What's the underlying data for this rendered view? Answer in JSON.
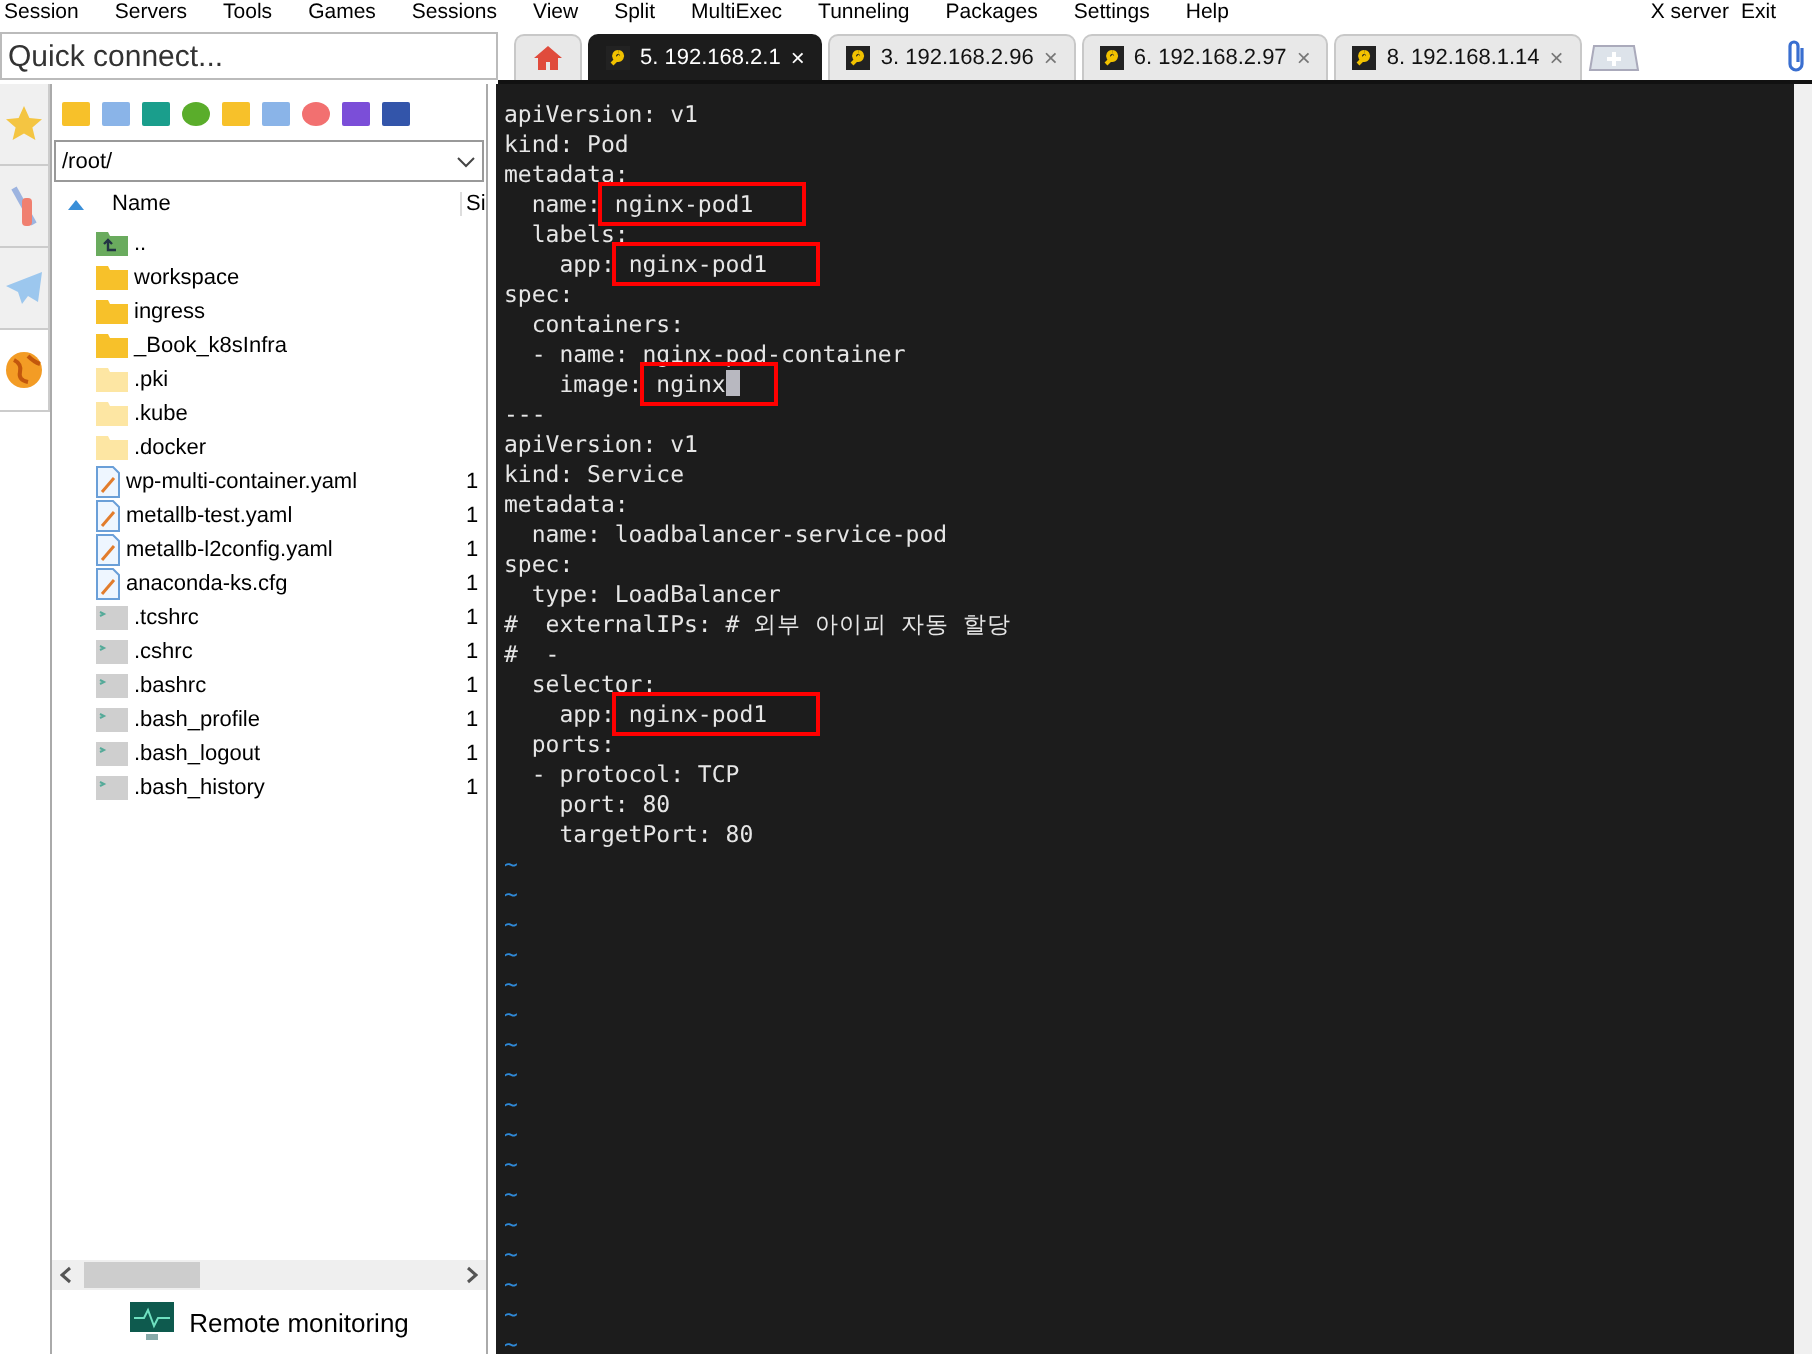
{
  "menu": [
    "Session",
    "Servers",
    "Tools",
    "Games",
    "Sessions",
    "View",
    "Split",
    "MultiExec",
    "Tunneling",
    "Packages",
    "Settings",
    "Help",
    "X server",
    "Exit"
  ],
  "quick_connect": {
    "placeholder": "Quick connect..."
  },
  "tabs": [
    {
      "kind": "home",
      "selected": false
    },
    {
      "kind": "session",
      "label": "5. 192.168.2.1",
      "close": "×",
      "selected": true
    },
    {
      "kind": "session",
      "label": "3. 192.168.2.96",
      "close": "×",
      "selected": false
    },
    {
      "kind": "session",
      "label": "6. 192.168.2.97",
      "close": "×",
      "selected": false
    },
    {
      "kind": "session",
      "label": "8. 192.168.1.14",
      "close": "×",
      "selected": false
    }
  ],
  "side_tabs": [
    {
      "kind": "star",
      "selected": false
    },
    {
      "kind": "tools",
      "selected": false
    },
    {
      "kind": "plane",
      "selected": false
    },
    {
      "kind": "globe",
      "selected": true
    }
  ],
  "file_browser": {
    "path": "/root/",
    "columns": [
      "Name",
      "Si"
    ],
    "rows": [
      {
        "kind": "parent",
        "name": "..",
        "size": ""
      },
      {
        "kind": "folder",
        "name": "workspace",
        "size": ""
      },
      {
        "kind": "folder",
        "name": "ingress",
        "size": ""
      },
      {
        "kind": "folder",
        "name": "_Book_k8sInfra",
        "size": ""
      },
      {
        "kind": "hidden_folder",
        "name": ".pki",
        "size": ""
      },
      {
        "kind": "hidden_folder",
        "name": ".kube",
        "size": ""
      },
      {
        "kind": "hidden_folder",
        "name": ".docker",
        "size": ""
      },
      {
        "kind": "text_file",
        "name": "wp-multi-container.yaml",
        "size": "1"
      },
      {
        "kind": "text_file",
        "name": "metallb-test.yaml",
        "size": "1"
      },
      {
        "kind": "text_file",
        "name": "metallb-l2config.yaml",
        "size": "1"
      },
      {
        "kind": "text_file",
        "name": "anaconda-ks.cfg",
        "size": "1"
      },
      {
        "kind": "script",
        "name": ".tcshrc",
        "size": "1"
      },
      {
        "kind": "script",
        "name": ".cshrc",
        "size": "1"
      },
      {
        "kind": "script",
        "name": ".bashrc",
        "size": "1"
      },
      {
        "kind": "script",
        "name": ".bash_profile",
        "size": "1"
      },
      {
        "kind": "script",
        "name": ".bash_logout",
        "size": "1"
      },
      {
        "kind": "script",
        "name": ".bash_history",
        "size": "1"
      }
    ],
    "footer": "Remote monitoring"
  },
  "terminal": {
    "lines": [
      {
        "text": "apiVersion: v1",
        "cursor": false
      },
      {
        "text": "kind: Pod",
        "cursor": false
      },
      {
        "text": "metadata:",
        "cursor": false
      },
      {
        "text": "  name: ",
        "marked": "nginx-pod1",
        "cursor": false
      },
      {
        "text": "  labels:",
        "cursor": false
      },
      {
        "text": "    app: ",
        "marked": "nginx-pod1",
        "cursor": false
      },
      {
        "text": "spec:",
        "cursor": false
      },
      {
        "text": "  containers:",
        "cursor": false
      },
      {
        "text": "  - name: nginx-pod-container",
        "cursor": false
      },
      {
        "text": "    image: ",
        "marked": "nginx",
        "cursor": true
      },
      {
        "text": "---",
        "cursor": false
      },
      {
        "text": "apiVersion: v1",
        "cursor": false
      },
      {
        "text": "kind: Service",
        "cursor": false
      },
      {
        "text": "metadata:",
        "cursor": false
      },
      {
        "text": "  name: loadbalancer-service-pod",
        "cursor": false
      },
      {
        "text": "spec:",
        "cursor": false
      },
      {
        "text": "  type: LoadBalancer",
        "cursor": false
      },
      {
        "text": "#  externalIPs: # 외부 아이피 자동 할당",
        "cursor": false
      },
      {
        "text": "#  -",
        "cursor": false
      },
      {
        "text": "  selector:",
        "cursor": false
      },
      {
        "text": "    app: ",
        "marked": "nginx-pod1",
        "cursor": false
      },
      {
        "text": "  ports:",
        "cursor": false
      },
      {
        "text": "  - protocol: TCP",
        "cursor": false
      },
      {
        "text": "    port: 80",
        "cursor": false
      },
      {
        "text": "    targetPort: 80",
        "cursor": false
      }
    ],
    "tildes": [
      "~",
      "~",
      "~",
      "~",
      "~",
      "~",
      "~",
      "~",
      "~",
      "~",
      "~",
      "~",
      "~",
      "~",
      "~",
      "~",
      "~"
    ]
  }
}
